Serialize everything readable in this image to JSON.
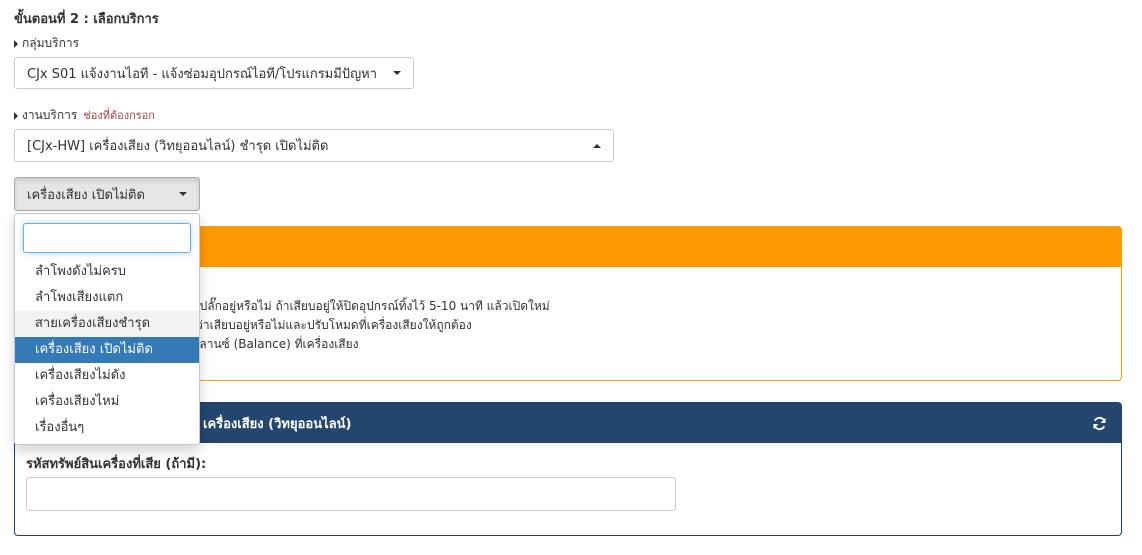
{
  "step_title": "ขั้นตอนที่ 2 : เลือกบริการ",
  "service_group": {
    "label": "กลุ่มบริการ",
    "selected": "CJx S01 แจ้งงานไอที - แจ้งซ่อมอุปกรณ์ไอที/โปรแกรมมีปัญหา"
  },
  "service_work": {
    "label": "งานบริการ",
    "required_note": "ช่องที่ต้องกรอก",
    "selected": "[CJx-HW] เครื่องเสียง (วิทยุออนไลน์) ชำรุด เปิดไม่ติด"
  },
  "issue_dropdown": {
    "selected": "เครื่องเสียง เปิดไม่ติด",
    "search_value": "",
    "options": [
      "ลำโพงดังไม่ครบ",
      "ลำโพงเสียงแตก",
      "สายเครื่องเสียงชำรุด",
      "เครื่องเสียง เปิดไม่ติด",
      "เครื่องเสียงไม่ดัง",
      "เครื่องเสียงไหม่",
      "เรื่องอื่นๆ"
    ],
    "hover_index": 2,
    "active_index": 3
  },
  "warning_panel": {
    "lines": [
      "ยบปลั๊กอยู่หรือไม่ ถ้าเสียบอยู่ให้ปิดอุปกรณ์ทิ้งไว้ 5-10 นาที แล้วเปิดใหม่",
      "ณว่าเสียบอยู่หรือไม่และปรับโหมดที่เครื่องเสียงให้ถูกต้อง",
      "บาลานซ์ (Balance) ที่เครื่องเสียง"
    ]
  },
  "info_panel": {
    "title": "เครื่องเสียง (วิทยุออนไลน์)",
    "field_label": "รหัสทรัพย์สินเครื่องที่เสีย (ถ้ามี):",
    "field_value": ""
  },
  "colors": {
    "warning_header": "#ff9800",
    "info_header": "#23466f",
    "active_item": "#337ab7"
  }
}
